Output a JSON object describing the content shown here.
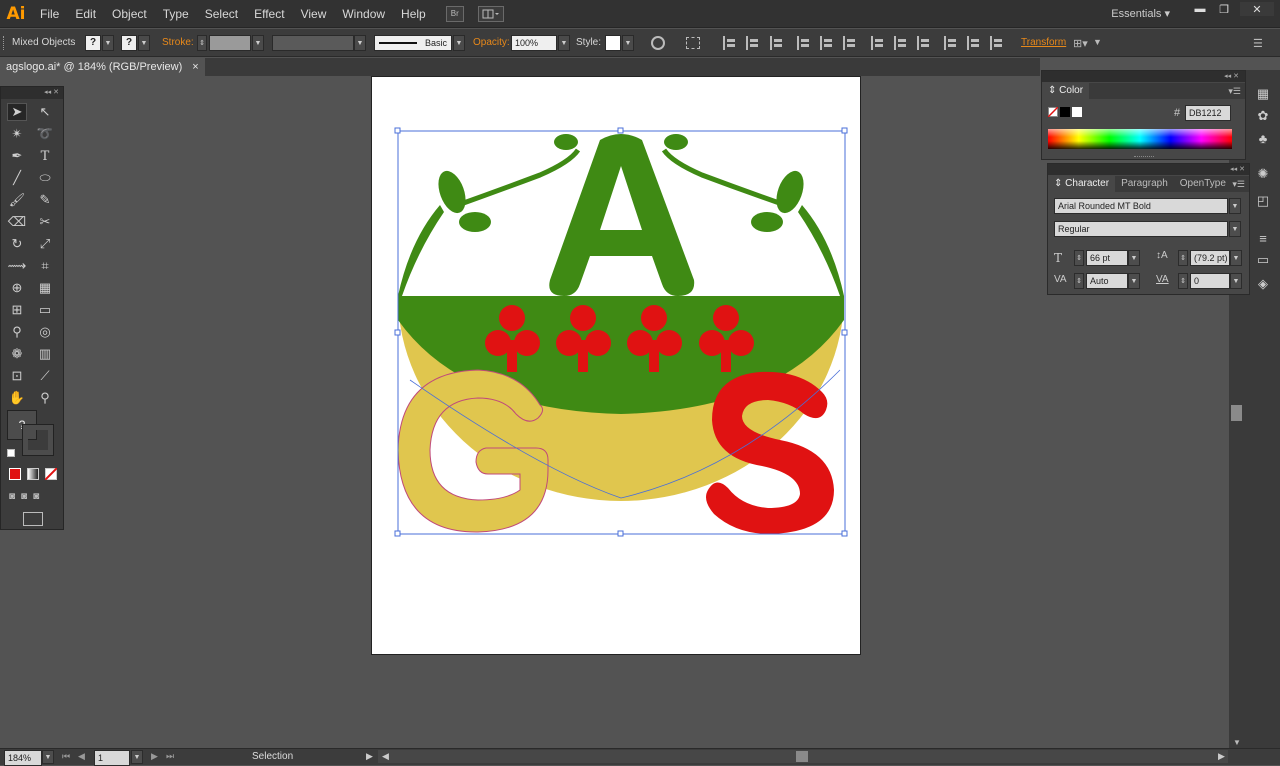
{
  "app": {
    "logo": "Ai",
    "workspace": "Essentials"
  },
  "menu": [
    "File",
    "Edit",
    "Object",
    "Type",
    "Select",
    "Effect",
    "View",
    "Window",
    "Help"
  ],
  "menu_buttons": {
    "bridge": "Br"
  },
  "controlbar": {
    "selection_type": "Mixed Objects",
    "fill_value": "?",
    "stroke_swatch_value": "?",
    "stroke_label": "Stroke:",
    "brush_label": "Basic",
    "opacity_label": "Opacity:",
    "opacity_value": "100%",
    "style_label": "Style:",
    "transform_label": "Transform"
  },
  "document": {
    "tab_title": "agslogo.ai* @ 184% (RGB/Preview)",
    "close_glyph": "×"
  },
  "tools": {
    "unknown_fill": "?"
  },
  "color_panel": {
    "title": "Color",
    "hex_label": "#",
    "hex_value": "DB1212"
  },
  "character_panel": {
    "tabs": [
      "Character",
      "Paragraph",
      "OpenType"
    ],
    "font_family": "Arial Rounded MT Bold",
    "font_style": "Regular",
    "font_size": "66 pt",
    "leading": "(79.2 pt)",
    "kerning": "Auto",
    "tracking": "0"
  },
  "statusbar": {
    "zoom": "184%",
    "page": "1",
    "tool_status": "Selection"
  },
  "colors": {
    "green": "#3f8a14",
    "yellow": "#e0c64e",
    "red": "#e01212",
    "selection": "#4a6fd8",
    "accent_orange": "#e8891a"
  }
}
